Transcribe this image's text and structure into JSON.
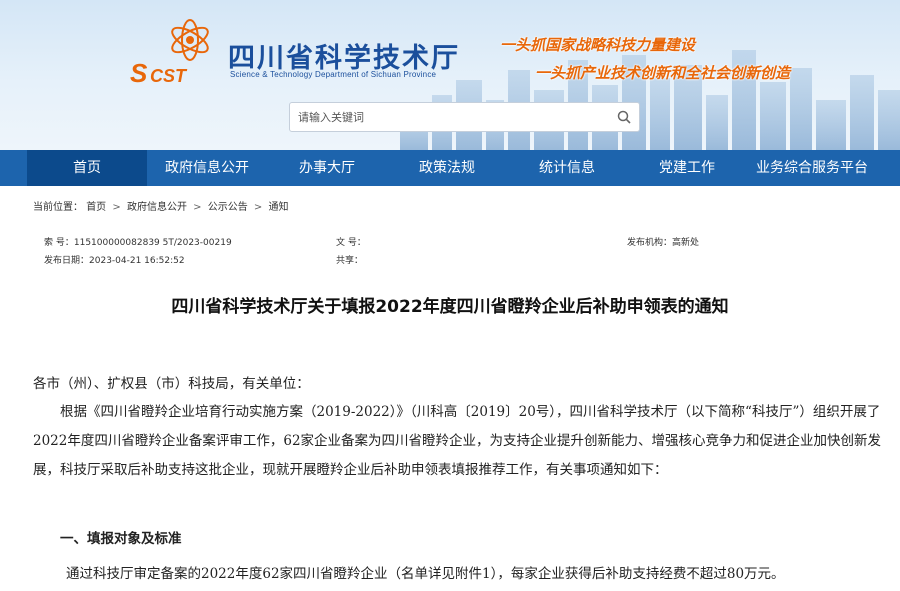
{
  "header": {
    "site_title": "四川省科学技术厅",
    "site_subtitle": "Science & Technology Department of Sichuan Province",
    "logo_text": "SCST",
    "slogan_1": "一头抓国家战略科技力量建设",
    "slogan_2": "一头抓产业技术创新和全社会创新创造",
    "search_placeholder": "请输入关键词"
  },
  "nav": {
    "items": [
      {
        "label": "首页",
        "active": true
      },
      {
        "label": "政府信息公开"
      },
      {
        "label": "办事大厅"
      },
      {
        "label": "政策法规"
      },
      {
        "label": "统计信息"
      },
      {
        "label": "党建工作"
      },
      {
        "label": "业务综合服务平台"
      }
    ]
  },
  "breadcrumb": {
    "prefix": "当前位置：",
    "items": [
      "首页",
      "政府信息公开",
      "公示公告",
      "通知"
    ],
    "separator": ">"
  },
  "meta": {
    "index_label": "索  号：",
    "index_value": "115100000082839 5T/2023-00219",
    "doc_no_label": "文  号：",
    "doc_no_value": "",
    "publisher_label": "发布机构：",
    "publisher_value": "高新处",
    "date_label": "发布日期：",
    "date_value": "2023-04-21 16:52:52",
    "share_label": "共享：",
    "share_value": ""
  },
  "doc": {
    "title": "四川省科学技术厅关于填报2022年度四川省瞪羚企业后补助申领表的通知",
    "salutation": "各市（州）、扩权县（市）科技局，有关单位：",
    "paragraph_1": "根据《四川省瞪羚企业培育行动实施方案（2019-2022）》（川科高〔2019〕20号），四川省科学技术厅（以下简称“科技厅”）组织开展了2022年度四川省瞪羚企业备案评审工作，62家企业备案为四川省瞪羚企业，为支持企业提升创新能力、增强核心竞争力和促进企业加快创新发展，科技厅采取后补助支持这批企业，现就开展瞪羚企业后补助申领表填报推荐工作，有关事项通知如下：",
    "heading_1": "一、填报对象及标准",
    "paragraph_2": "通过科技厅审定备案的2022年度62家四川省瞪羚企业（名单详见附件1），每家企业获得后补助支持经费不超过80万元。"
  },
  "colors": {
    "nav_bg": "#1d64ad",
    "nav_active": "#0c4a8c",
    "brand_blue": "#1b4f9c",
    "slogan_orange": "#e8670a"
  }
}
